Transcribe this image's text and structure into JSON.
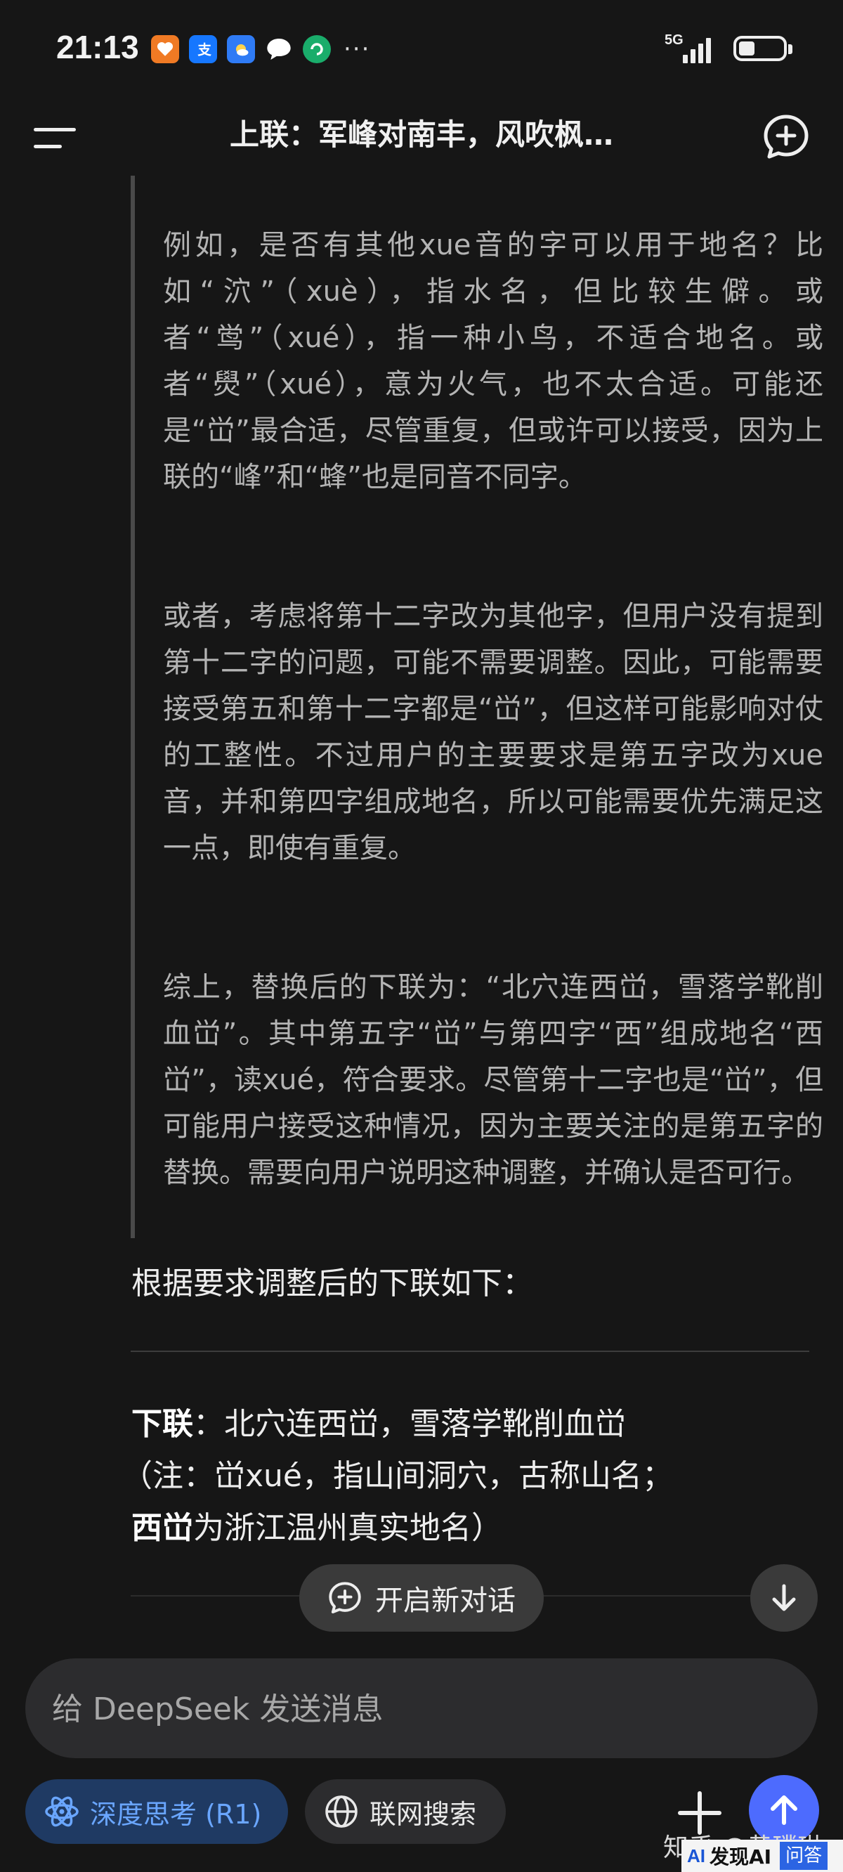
{
  "status_bar": {
    "time": "21:13",
    "network": "5G",
    "apps": [
      {
        "icon": "heart-app-icon",
        "color": "#f07a24"
      },
      {
        "icon": "alipay-app-icon",
        "color": "#1677ff"
      },
      {
        "icon": "weather-app-icon",
        "color": "#2f7bf5"
      },
      {
        "icon": "message-app-icon",
        "color": "#ffffff"
      },
      {
        "icon": "green-app-icon",
        "color": "#1aad6b"
      }
    ],
    "more": "···"
  },
  "header": {
    "title": "上联：军峰对南丰，风吹枫…"
  },
  "thinking": {
    "paragraphs": [
      "例如，是否有其他xue音的字可以用于地名？比如“泬”（xuè），指水名，但比较生僻。或者“鸴”（xué），指一种小鸟，不适合地名。或者“燢”（xué），意为火气，也不太合适。可能还是“峃”最合适，尽管重复，但或许可以接受，因为上联的“峰”和“蜂”也是同音不同字。",
      "或者，考虑将第十二字改为其他字，但用户没有提到第十二字的问题，可能不需要调整。因此，可能需要接受第五和第十二字都是“峃”，但这样可能影响对仗的工整性。不过用户的主要要求是第五字改为xue音，并和第四字组成地名，所以可能需要优先满足这一点，即使有重复。",
      "综上，替换后的下联为：“北穴连西峃，雪落学靴削血峃”。其中第五字“峃”与第四字“西”组成地名“西峃”，读xué，符合要求。尽管第十二字也是“峃”，但可能用户接受这种情况，因为主要关注的是第五字的替换。需要向用户说明这种调整，并确认是否可行。"
    ]
  },
  "answer": {
    "intro": "根据要求调整后的下联如下：",
    "label": "下联",
    "label_colon": "：",
    "line": "北穴连西峃，雪落学靴削血峃",
    "note_prefix": "（注：峃xué，指山间洞穴，古称山名；",
    "note_place": "西峃",
    "note_suffix": "为浙江温州真实地名）"
  },
  "new_chat_button": "开启新对话",
  "input": {
    "placeholder": "给 DeepSeek 发送消息"
  },
  "toolbar": {
    "deep_think": "深度思考 (R1)",
    "web_search": "联网搜索"
  },
  "watermark": {
    "text": "知乎 @黄璞琳",
    "badge_text": "发现AI",
    "badge_qa": "问答"
  },
  "colors": {
    "background": "#161616",
    "accent": "#4d6bfe",
    "deep_think_bg": "#1f3a63",
    "deep_think_fg": "#6aa6ff"
  }
}
